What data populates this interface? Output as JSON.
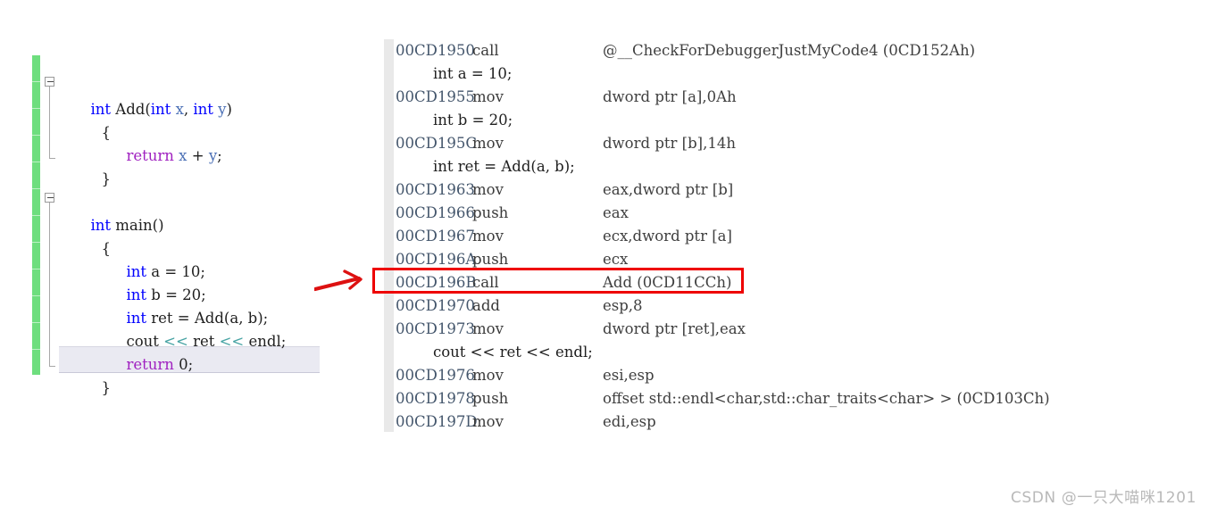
{
  "source_panel": {
    "name": "source-code-editor",
    "change_bar_color": "#6ede7e",
    "current_line_highlight_color": "#eaeaf2",
    "lines": [
      {
        "indent": 0,
        "tokens": [
          {
            "t": "int",
            "c": "kw-type"
          },
          {
            "t": " Add",
            "c": "plain"
          },
          {
            "t": "(",
            "c": "plain"
          },
          {
            "t": "int",
            "c": "kw-type"
          },
          {
            "t": " ",
            "c": "plain"
          },
          {
            "t": "x",
            "c": "param"
          },
          {
            "t": ", ",
            "c": "plain"
          },
          {
            "t": "int",
            "c": "kw-type"
          },
          {
            "t": " ",
            "c": "plain"
          },
          {
            "t": "y",
            "c": "param"
          },
          {
            "t": ")",
            "c": "plain"
          }
        ],
        "text": "int Add(int x, int y)"
      },
      {
        "indent": 1,
        "tokens": [
          {
            "t": "{",
            "c": "brace"
          }
        ],
        "text": "{"
      },
      {
        "indent": 2,
        "tokens": [
          {
            "t": "return",
            "c": "kw-ctrl"
          },
          {
            "t": " ",
            "c": "plain"
          },
          {
            "t": "x",
            "c": "param"
          },
          {
            "t": " + ",
            "c": "plain"
          },
          {
            "t": "y",
            "c": "param"
          },
          {
            "t": ";",
            "c": "plain"
          }
        ],
        "text": "return x + y;"
      },
      {
        "indent": 1,
        "tokens": [
          {
            "t": "}",
            "c": "brace"
          }
        ],
        "text": "}"
      },
      {
        "indent": 0,
        "tokens": [],
        "text": ""
      },
      {
        "indent": 0,
        "tokens": [
          {
            "t": "int",
            "c": "kw-type"
          },
          {
            "t": " main",
            "c": "plain"
          },
          {
            "t": "()",
            "c": "plain"
          }
        ],
        "text": "int main()"
      },
      {
        "indent": 1,
        "tokens": [
          {
            "t": "{",
            "c": "brace"
          }
        ],
        "text": "{"
      },
      {
        "indent": 2,
        "tokens": [
          {
            "t": "int",
            "c": "kw-type"
          },
          {
            "t": " a = ",
            "c": "plain"
          },
          {
            "t": "10",
            "c": "plain"
          },
          {
            "t": ";",
            "c": "plain"
          }
        ],
        "text": "int a = 10;"
      },
      {
        "indent": 2,
        "tokens": [
          {
            "t": "int",
            "c": "kw-type"
          },
          {
            "t": " b = ",
            "c": "plain"
          },
          {
            "t": "20",
            "c": "plain"
          },
          {
            "t": ";",
            "c": "plain"
          }
        ],
        "text": "int b = 20;"
      },
      {
        "indent": 2,
        "tokens": [
          {
            "t": "int",
            "c": "kw-type"
          },
          {
            "t": " ret = Add(a, b);",
            "c": "plain"
          }
        ],
        "text": "int ret = Add(a, b);"
      },
      {
        "indent": 2,
        "tokens": [
          {
            "t": "cout ",
            "c": "plain"
          },
          {
            "t": "<<",
            "c": "op-stream"
          },
          {
            "t": " ret ",
            "c": "plain"
          },
          {
            "t": "<<",
            "c": "op-stream"
          },
          {
            "t": " endl;",
            "c": "plain"
          }
        ],
        "text": "cout << ret << endl;"
      },
      {
        "indent": 2,
        "tokens": [
          {
            "t": "return",
            "c": "kw-ctrl"
          },
          {
            "t": " ",
            "c": "plain"
          },
          {
            "t": "0",
            "c": "plain"
          },
          {
            "t": ";",
            "c": "plain"
          }
        ],
        "text": "return 0;"
      },
      {
        "indent": 1,
        "tokens": [
          {
            "t": "}",
            "c": "brace"
          }
        ],
        "text": "}"
      }
    ]
  },
  "disassembly_panel": {
    "name": "disassembly-view",
    "gutter_color": "#e9e9e9",
    "highlight": {
      "name": "call-instruction-highlight",
      "color": "#ee0000",
      "target_address": "00CD196B",
      "target_text": "00CD196B  call        Add (0CD11CCh)"
    },
    "rows": [
      {
        "kind": "asm",
        "clipped": true,
        "address": "00CD1950",
        "mnemonic": "call",
        "operands": "@__CheckForDebuggerJustMyCode4 (0CD152Ah)",
        "text": "00CD1950  call        @__CheckForDebuggerJustMyCode4 (0CD152Ah)"
      },
      {
        "kind": "src",
        "text": "int a = 10;"
      },
      {
        "kind": "asm",
        "address": "00CD1955",
        "mnemonic": "mov",
        "operands": "dword ptr [a],0Ah",
        "text": "00CD1955  mov         dword ptr [a],0Ah"
      },
      {
        "kind": "src",
        "text": "int b = 20;"
      },
      {
        "kind": "asm",
        "address": "00CD195C",
        "mnemonic": "mov",
        "operands": "dword ptr [b],14h",
        "text": "00CD195C  mov         dword ptr [b],14h"
      },
      {
        "kind": "src",
        "text": "int ret = Add(a, b);"
      },
      {
        "kind": "asm",
        "address": "00CD1963",
        "mnemonic": "mov",
        "operands": "eax,dword ptr [b]",
        "text": "00CD1963  mov         eax,dword ptr [b]"
      },
      {
        "kind": "asm",
        "address": "00CD1966",
        "mnemonic": "push",
        "operands": "eax",
        "text": "00CD1966  push        eax"
      },
      {
        "kind": "asm",
        "address": "00CD1967",
        "mnemonic": "mov",
        "operands": "ecx,dword ptr [a]",
        "text": "00CD1967  mov         ecx,dword ptr [a]"
      },
      {
        "kind": "asm",
        "address": "00CD196A",
        "mnemonic": "push",
        "operands": "ecx",
        "text": "00CD196A  push        ecx"
      },
      {
        "kind": "asm",
        "address": "00CD196B",
        "mnemonic": "call",
        "operands": "Add (0CD11CCh)",
        "highlighted": true,
        "text": "00CD196B  call        Add (0CD11CCh)"
      },
      {
        "kind": "asm",
        "address": "00CD1970",
        "mnemonic": "add",
        "operands": "esp,8",
        "text": "00CD1970  add         esp,8"
      },
      {
        "kind": "asm",
        "address": "00CD1973",
        "mnemonic": "mov",
        "operands": "dword ptr [ret],eax",
        "text": "00CD1973  mov         dword ptr [ret],eax"
      },
      {
        "kind": "src",
        "text": "cout << ret << endl;"
      },
      {
        "kind": "asm",
        "address": "00CD1976",
        "mnemonic": "mov",
        "operands": "esi,esp",
        "text": "00CD1976  mov         esi,esp"
      },
      {
        "kind": "asm",
        "address": "00CD1978",
        "mnemonic": "push",
        "operands": "offset std::endl<char,std::char_traits<char> > (0CD103Ch)",
        "text": "00CD1978  push        offset std::endl<char,std::char_traits<char> > (0CD103Ch)"
      },
      {
        "kind": "asm",
        "address": "00CD197D",
        "mnemonic": "mov",
        "operands": "edi,esp",
        "text": "00CD197D  mov         edi,esp"
      }
    ]
  },
  "annotation": {
    "name": "red-arrow-annotation",
    "color": "#dd1111",
    "description": "hand-drawn arrow pointing from source call line to disassembly call row"
  },
  "watermark": {
    "text": "CSDN @一只大喵咪1201",
    "color": "#b9b9b9"
  }
}
